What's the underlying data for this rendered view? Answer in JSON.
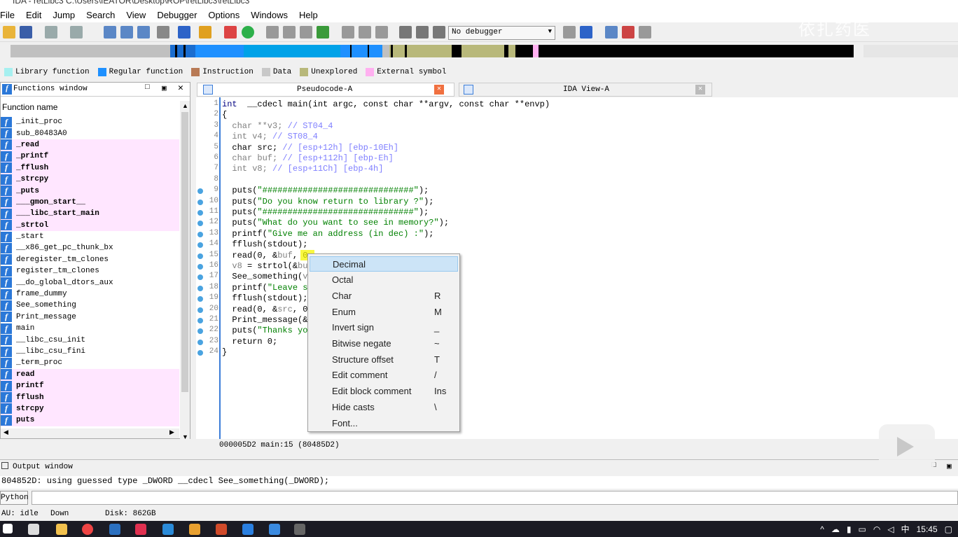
{
  "window": {
    "title": "IDA - retLibc3 C:\\Users\\IEATOR\\Desktop\\ROP\\retLibc3\\retLibc3"
  },
  "menu": [
    "File",
    "Edit",
    "Jump",
    "Search",
    "View",
    "Debugger",
    "Options",
    "Windows",
    "Help"
  ],
  "toolbar": {
    "debugger_select": "No debugger"
  },
  "legend": [
    {
      "label": "Library function",
      "color": "#a6f0f0"
    },
    {
      "label": "Regular function",
      "color": "#1e90ff"
    },
    {
      "label": "Instruction",
      "color": "#b87a55"
    },
    {
      "label": "Data",
      "color": "#c8c8c8"
    },
    {
      "label": "Unexplored",
      "color": "#b8b87a"
    },
    {
      "label": "External symbol",
      "color": "#ffb0f0"
    }
  ],
  "functions_window": {
    "title": "Functions window",
    "column_header": "Function name",
    "items": [
      {
        "name": "_init_proc",
        "lib": false
      },
      {
        "name": "sub_80483A0",
        "lib": false
      },
      {
        "name": "_read",
        "lib": true
      },
      {
        "name": "_printf",
        "lib": true
      },
      {
        "name": "_fflush",
        "lib": true
      },
      {
        "name": "_strcpy",
        "lib": true
      },
      {
        "name": "_puts",
        "lib": true
      },
      {
        "name": "___gmon_start__",
        "lib": true
      },
      {
        "name": "___libc_start_main",
        "lib": true
      },
      {
        "name": "_strtol",
        "lib": true
      },
      {
        "name": "_start",
        "lib": false
      },
      {
        "name": "__x86_get_pc_thunk_bx",
        "lib": false
      },
      {
        "name": "deregister_tm_clones",
        "lib": false
      },
      {
        "name": "register_tm_clones",
        "lib": false
      },
      {
        "name": "__do_global_dtors_aux",
        "lib": false
      },
      {
        "name": "frame_dummy",
        "lib": false
      },
      {
        "name": "See_something",
        "lib": false
      },
      {
        "name": "Print_message",
        "lib": false
      },
      {
        "name": "main",
        "lib": false
      },
      {
        "name": "__libc_csu_init",
        "lib": false
      },
      {
        "name": "__libc_csu_fini",
        "lib": false
      },
      {
        "name": "_term_proc",
        "lib": false
      },
      {
        "name": "read",
        "lib": true
      },
      {
        "name": "printf",
        "lib": true
      },
      {
        "name": "fflush",
        "lib": true
      },
      {
        "name": "strcpy",
        "lib": true
      },
      {
        "name": "puts",
        "lib": true
      }
    ]
  },
  "tabs": {
    "pseudocode": "Pseudocode-A",
    "ida_view": "IDA View-A"
  },
  "code": [
    {
      "n": "1",
      "bp": false,
      "parts": [
        [
          "kw",
          "int"
        ],
        [
          "",
          "  __cdecl main(int argc, const char **argv, const char **envp)"
        ]
      ]
    },
    {
      "n": "2",
      "bp": false,
      "parts": [
        [
          "",
          "{"
        ]
      ]
    },
    {
      "n": "3",
      "bp": false,
      "parts": [
        [
          "gray",
          "  char **v3; "
        ],
        [
          "cm",
          "// ST04_4"
        ]
      ]
    },
    {
      "n": "4",
      "bp": false,
      "parts": [
        [
          "gray",
          "  int v4; "
        ],
        [
          "cm",
          "// ST08_4"
        ]
      ]
    },
    {
      "n": "5",
      "bp": false,
      "parts": [
        [
          "",
          "  char src; "
        ],
        [
          "cm",
          "// [esp+12h] [ebp-10Eh]"
        ]
      ]
    },
    {
      "n": "6",
      "bp": false,
      "parts": [
        [
          "gray",
          "  char buf; "
        ],
        [
          "cm",
          "// [esp+112h] [ebp-Eh]"
        ]
      ]
    },
    {
      "n": "7",
      "bp": false,
      "parts": [
        [
          "gray",
          "  int v8; "
        ],
        [
          "cm",
          "// [esp+11Ch] [ebp-4h]"
        ]
      ]
    },
    {
      "n": "8",
      "bp": false,
      "parts": [
        [
          "",
          ""
        ]
      ]
    },
    {
      "n": "9",
      "bp": true,
      "parts": [
        [
          "",
          "  puts("
        ],
        [
          "str",
          "\"##############################\""
        ],
        [
          "",
          ");"
        ]
      ]
    },
    {
      "n": "10",
      "bp": true,
      "parts": [
        [
          "",
          "  puts("
        ],
        [
          "str",
          "\"Do you know return to library ?\""
        ],
        [
          "",
          ");"
        ]
      ]
    },
    {
      "n": "11",
      "bp": true,
      "parts": [
        [
          "",
          "  puts("
        ],
        [
          "str",
          "\"##############################\""
        ],
        [
          "",
          ");"
        ]
      ]
    },
    {
      "n": "12",
      "bp": true,
      "parts": [
        [
          "",
          "  puts("
        ],
        [
          "str",
          "\"What do you want to see in memory?\""
        ],
        [
          "",
          ");"
        ]
      ]
    },
    {
      "n": "13",
      "bp": true,
      "parts": [
        [
          "",
          "  printf("
        ],
        [
          "str",
          "\"Give me an address (in dec) :\""
        ],
        [
          "",
          ");"
        ]
      ]
    },
    {
      "n": "14",
      "bp": true,
      "parts": [
        [
          "",
          "  fflush(stdout);"
        ]
      ]
    },
    {
      "n": "15",
      "bp": true,
      "parts": [
        [
          "",
          "  read(0, &"
        ],
        [
          "gray",
          "buf"
        ],
        [
          "",
          ", 0"
        ]
      ]
    },
    {
      "n": "16",
      "bp": true,
      "parts": [
        [
          "gray",
          "  v8"
        ],
        [
          "",
          " = strtol(&"
        ],
        [
          "gray",
          "bu"
        ]
      ]
    },
    {
      "n": "17",
      "bp": true,
      "parts": [
        [
          "",
          "  See_something("
        ],
        [
          "gray",
          "v"
        ]
      ]
    },
    {
      "n": "18",
      "bp": true,
      "parts": [
        [
          "",
          "  printf("
        ],
        [
          "str",
          "\"Leave s"
        ]
      ]
    },
    {
      "n": "19",
      "bp": true,
      "parts": [
        [
          "",
          "  fflush(stdout);"
        ]
      ]
    },
    {
      "n": "20",
      "bp": true,
      "parts": [
        [
          "",
          "  read(0, &"
        ],
        [
          "gray",
          "src"
        ],
        [
          "",
          ", 0"
        ]
      ]
    },
    {
      "n": "21",
      "bp": true,
      "parts": [
        [
          "",
          "  Print_message(&"
        ]
      ]
    },
    {
      "n": "22",
      "bp": true,
      "parts": [
        [
          "",
          "  puts("
        ],
        [
          "str",
          "\"Thanks yo"
        ]
      ]
    },
    {
      "n": "23",
      "bp": true,
      "parts": [
        [
          "",
          "  return 0;"
        ]
      ]
    },
    {
      "n": "24",
      "bp": true,
      "parts": [
        [
          "",
          "}"
        ]
      ]
    }
  ],
  "code_status": "000005D2 main:15 (80485D2)",
  "context_menu": [
    {
      "label": "Decimal",
      "key": "",
      "hl": true
    },
    {
      "label": "Octal",
      "key": "",
      "hl": false
    },
    {
      "label": "Char",
      "key": "R",
      "hl": false
    },
    {
      "label": "Enum",
      "key": "M",
      "hl": false
    },
    {
      "label": "Invert sign",
      "key": "_",
      "hl": false
    },
    {
      "label": "Bitwise negate",
      "key": "~",
      "hl": false
    },
    {
      "label": "Structure offset",
      "key": "T",
      "hl": false
    },
    {
      "label": "Edit comment",
      "key": "/",
      "hl": false
    },
    {
      "label": "Edit block comment",
      "key": "Ins",
      "hl": false
    },
    {
      "label": "Hide casts",
      "key": "\\",
      "hl": false
    },
    {
      "label": "Font...",
      "key": "",
      "hl": false
    }
  ],
  "output": {
    "title": "Output window",
    "text": "804852D: using guessed type _DWORD __cdecl See_something(_DWORD);",
    "python_button": "Python"
  },
  "statusbar": {
    "au": "AU:  idle",
    "dir": "Down",
    "disk": "Disk: 862GB"
  },
  "clock": "15:45",
  "watermark": "依扎药医"
}
